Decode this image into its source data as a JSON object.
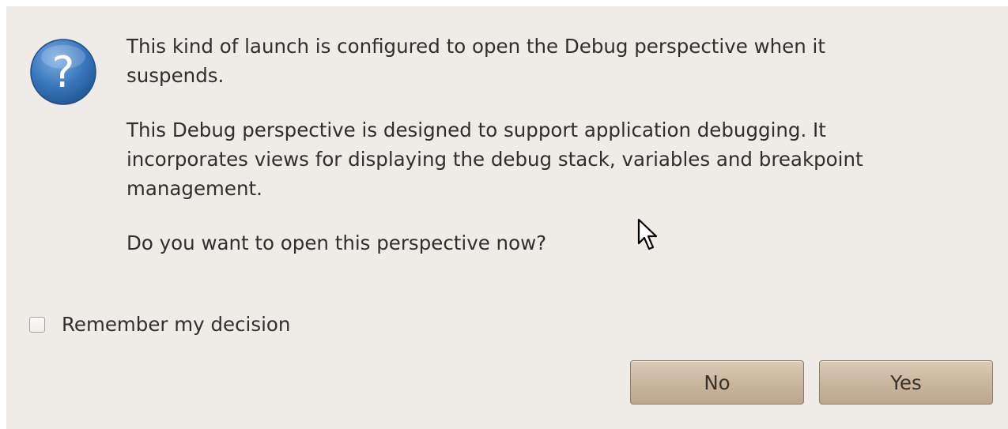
{
  "dialog": {
    "icon": "question-icon",
    "paragraphs": [
      "This kind of launch is configured to open the Debug perspective when it\nsuspends.",
      "This Debug perspective is designed to support application debugging.  It\nincorporates views for displaying the debug stack, variables and breakpoint\nmanagement.",
      "Do you want to open this perspective now?"
    ],
    "remember_label": "Remember my decision",
    "remember_checked": false,
    "no_label": "No",
    "yes_label": "Yes",
    "colors": {
      "background": "#efebe6",
      "icon_blue": "#2f6db0",
      "button": "#cab7a0"
    }
  }
}
